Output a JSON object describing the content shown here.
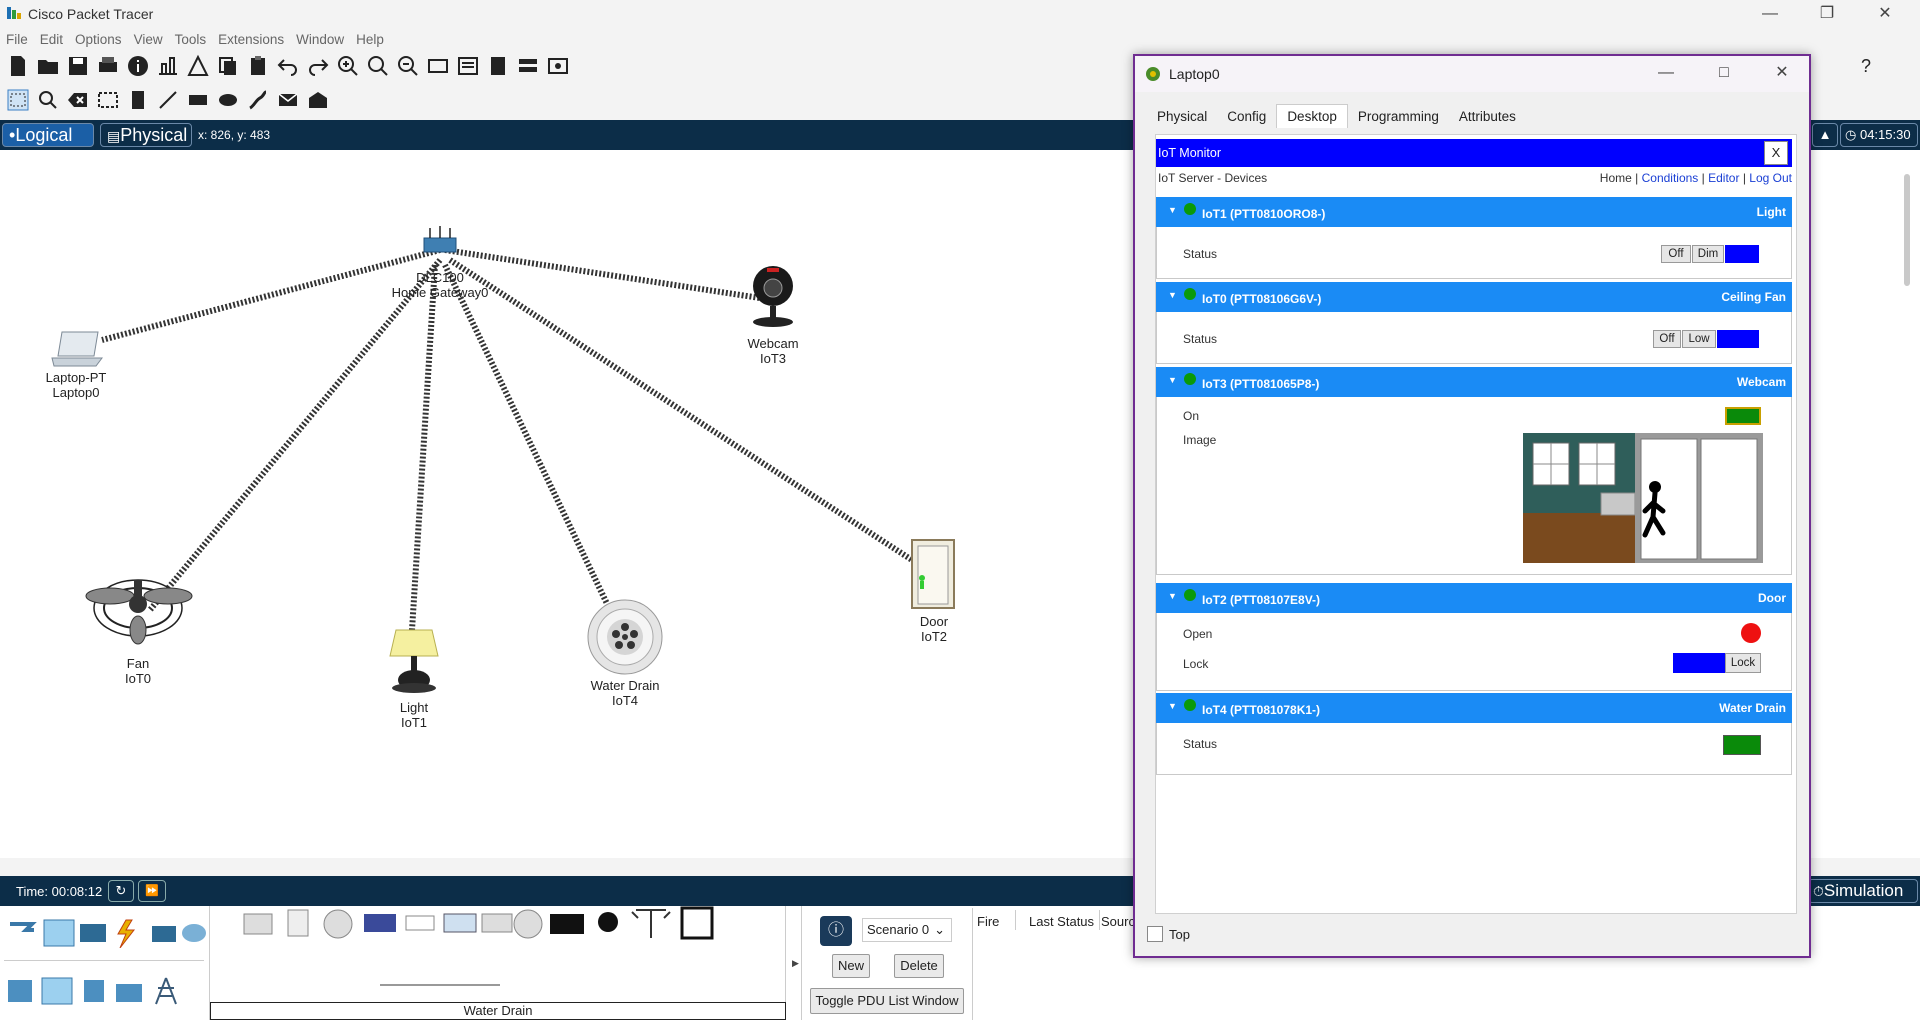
{
  "app": {
    "title": "Cisco Packet Tracer"
  },
  "menu": [
    "File",
    "Edit",
    "Options",
    "View",
    "Tools",
    "Extensions",
    "Window",
    "Help"
  ],
  "viewbar": {
    "logical": "Logical",
    "physical": "Physical",
    "coords": "x: 826, y: 483",
    "clock": "04:15:30"
  },
  "devices": [
    {
      "name": "laptop",
      "model": "Laptop-PT",
      "label": "Laptop0"
    },
    {
      "name": "gateway",
      "model": "DLC100",
      "label": "Home Gateway0"
    },
    {
      "name": "webcam",
      "model": "Webcam",
      "label": "IoT3"
    },
    {
      "name": "fan",
      "model": "Fan",
      "label": "IoT0"
    },
    {
      "name": "light",
      "model": "Light",
      "label": "IoT1"
    },
    {
      "name": "drain",
      "model": "Water Drain",
      "label": "IoT4"
    },
    {
      "name": "door",
      "model": "Door",
      "label": "IoT2"
    }
  ],
  "timebar": {
    "time": "Time: 00:08:12",
    "simulation": "Simulation"
  },
  "bottom": {
    "scenario": "Scenario 0",
    "new": "New",
    "delete": "Delete",
    "toggle": "Toggle PDU List Window",
    "fire": "Fire",
    "last_status": "Last Status",
    "source": "Sourc",
    "selected_device": "Water Drain"
  },
  "laptop_window": {
    "title": "Laptop0",
    "tabs": [
      "Physical",
      "Config",
      "Desktop",
      "Programming",
      "Attributes"
    ],
    "active_tab": "Desktop",
    "iot_header": "IoT Monitor",
    "close_x": "X",
    "server_title": "IoT Server - Devices",
    "nav": {
      "home": "Home",
      "conditions": "Conditions",
      "editor": "Editor",
      "logout": "Log Out",
      "sep": "|"
    },
    "top_checkbox": "Top",
    "iot_devices": [
      {
        "name": "IoT1 (PTT0810ORO8-)",
        "type": "Light",
        "rows": [
          {
            "label": "Status",
            "buttons": [
              "Off",
              "Dim"
            ]
          }
        ]
      },
      {
        "name": "IoT0 (PTT08106G6V-)",
        "type": "Ceiling Fan",
        "rows": [
          {
            "label": "Status",
            "buttons": [
              "Off",
              "Low"
            ]
          }
        ]
      },
      {
        "name": "IoT3 (PTT081065P8-)",
        "type": "Webcam",
        "rows": [
          {
            "label": "On"
          },
          {
            "label": "Image"
          }
        ]
      },
      {
        "name": "IoT2 (PTT08107E8V-)",
        "type": "Door",
        "rows": [
          {
            "label": "Open"
          },
          {
            "label": "Lock",
            "buttons": [
              "Lock"
            ]
          }
        ]
      },
      {
        "name": "IoT4 (PTT081078K1-)",
        "type": "Water Drain",
        "rows": [
          {
            "label": "Status"
          }
        ]
      }
    ]
  },
  "colors": {
    "accent_blue": "#1a8bf5",
    "deep_blue": "#0000ff",
    "status_green": "#0a8a0a",
    "alert_red": "#ee1111",
    "nav_bar": "#0c2d48",
    "window_border": "#6f2c91"
  }
}
